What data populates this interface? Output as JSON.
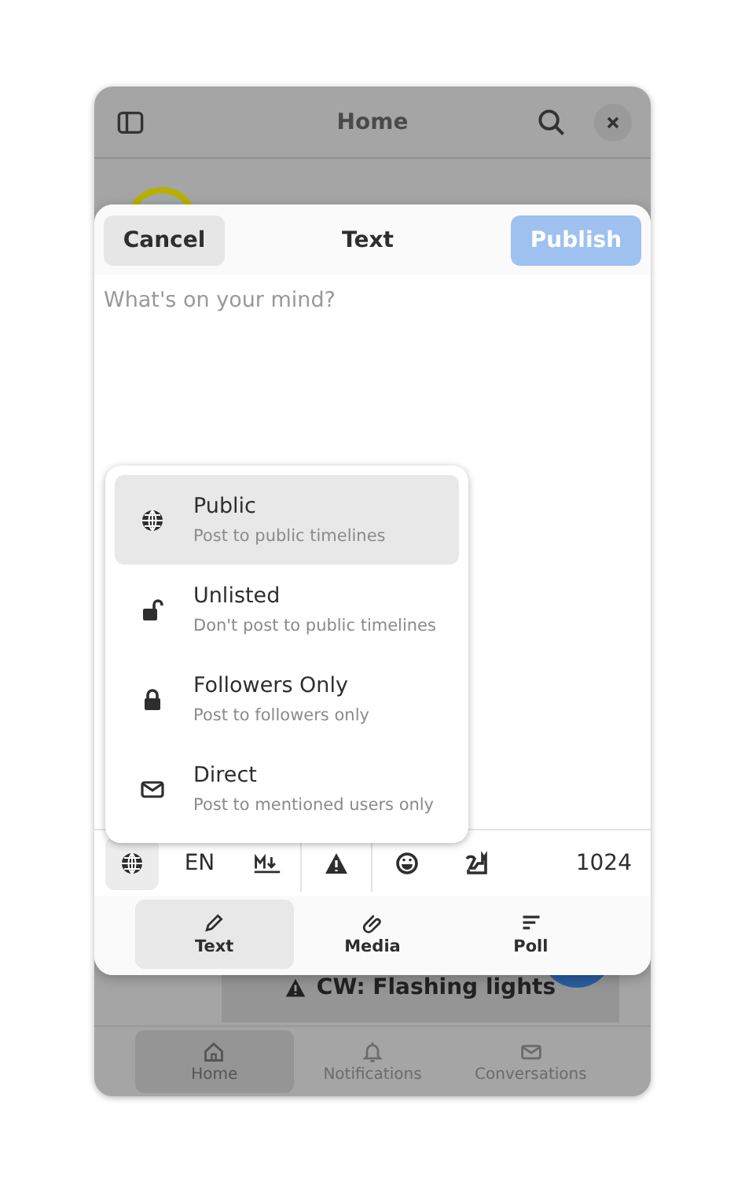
{
  "window": {
    "title": "Home"
  },
  "post": {
    "content_warning": "CW: Flashing lights"
  },
  "bottom_nav": [
    {
      "label": "Home",
      "kind": "home",
      "selected": true
    },
    {
      "label": "Notifications",
      "kind": "bell",
      "selected": false
    },
    {
      "label": "Conversations",
      "kind": "mail",
      "selected": false
    }
  ],
  "dialog": {
    "title": "Text",
    "cancel": "Cancel",
    "publish": "Publish",
    "publish_disabled": true,
    "placeholder": "What's on your mind?"
  },
  "visibility_menu": [
    {
      "label": "Public",
      "description": "Post to public timelines",
      "kind": "globe",
      "selected": true
    },
    {
      "label": "Unlisted",
      "description": "Don't post to public timelines",
      "kind": "unlocked",
      "selected": false
    },
    {
      "label": "Followers Only",
      "description": "Post to followers only",
      "kind": "locked",
      "selected": false
    },
    {
      "label": "Direct",
      "description": "Post to mentioned users only",
      "kind": "mail",
      "selected": false
    }
  ],
  "toolbar": {
    "visibility_open": true,
    "language": "EN",
    "remaining": "1024"
  },
  "compose_tabs": [
    {
      "label": "Text",
      "kind": "pencil",
      "selected": true
    },
    {
      "label": "Media",
      "kind": "clip",
      "selected": false
    },
    {
      "label": "Poll",
      "kind": "lines",
      "selected": false
    }
  ]
}
